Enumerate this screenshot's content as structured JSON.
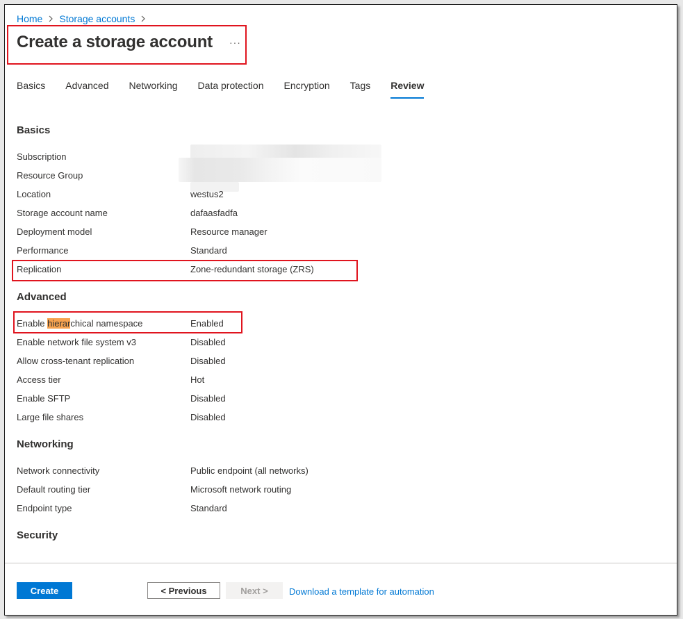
{
  "breadcrumb": {
    "home": "Home",
    "storage_accounts": "Storage accounts",
    "separator": ">"
  },
  "page": {
    "title": "Create a storage account",
    "more_icon": "ellipsis-icon",
    "more_label": "···"
  },
  "tabs": [
    {
      "label": "Basics",
      "active": false
    },
    {
      "label": "Advanced",
      "active": false
    },
    {
      "label": "Networking",
      "active": false
    },
    {
      "label": "Data protection",
      "active": false
    },
    {
      "label": "Encryption",
      "active": false
    },
    {
      "label": "Tags",
      "active": false
    },
    {
      "label": "Review",
      "active": true
    }
  ],
  "sections": {
    "basics": {
      "title": "Basics",
      "rows": [
        {
          "label": "Subscription",
          "value": ""
        },
        {
          "label": "Resource Group",
          "value": ""
        },
        {
          "label": "Location",
          "value": "westus2"
        },
        {
          "label": "Storage account name",
          "value": "dafaasfadfa"
        },
        {
          "label": "Deployment model",
          "value": "Resource manager"
        },
        {
          "label": "Performance",
          "value": "Standard"
        },
        {
          "label": "Replication",
          "value": "Zone-redundant storage (ZRS)"
        }
      ]
    },
    "advanced": {
      "title": "Advanced",
      "rows": [
        {
          "label_pre": "Enable ",
          "label_mark": "hierar",
          "label_post": "chical namespace",
          "value": "Enabled"
        },
        {
          "label": "Enable network file system v3",
          "value": "Disabled"
        },
        {
          "label": "Allow cross-tenant replication",
          "value": "Disabled"
        },
        {
          "label": "Access tier",
          "value": "Hot"
        },
        {
          "label": "Enable SFTP",
          "value": "Disabled"
        },
        {
          "label": "Large file shares",
          "value": "Disabled"
        }
      ]
    },
    "networking": {
      "title": "Networking",
      "rows": [
        {
          "label": "Network connectivity",
          "value": "Public endpoint (all networks)"
        },
        {
          "label": "Default routing tier",
          "value": "Microsoft network routing"
        },
        {
          "label": "Endpoint type",
          "value": "Standard"
        }
      ]
    },
    "security": {
      "title": "Security"
    }
  },
  "footer": {
    "create_label": "Create",
    "previous_label": "< Previous",
    "next_label": "Next >",
    "download_link": "Download a template for automation"
  },
  "colors": {
    "accent": "#0078d4",
    "highlight_box": "#e0141e",
    "search_mark": "#f7a350"
  }
}
